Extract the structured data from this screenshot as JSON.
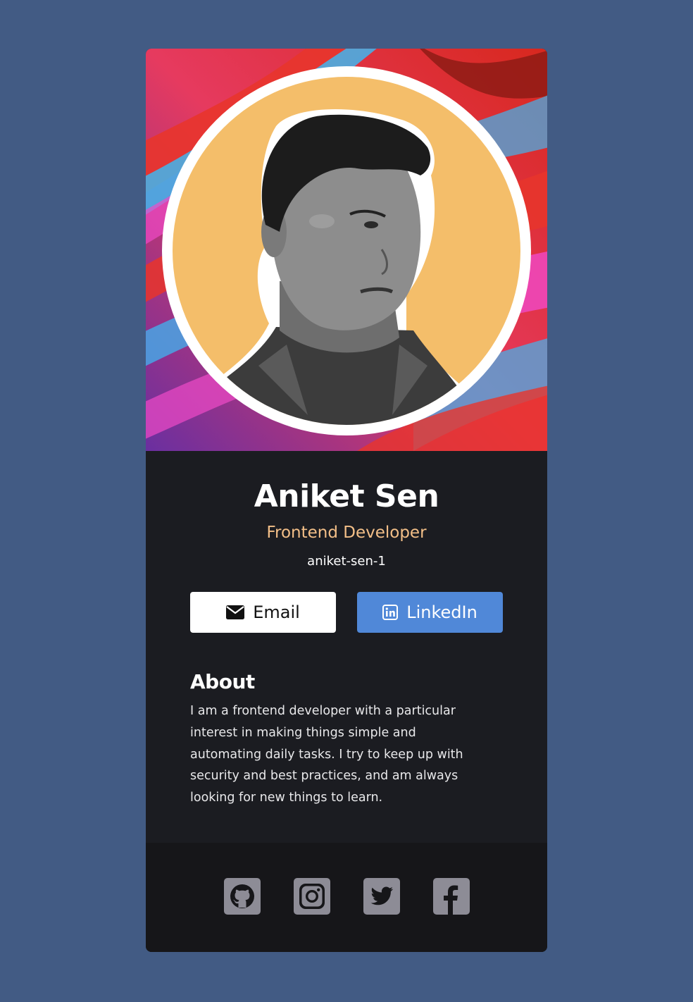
{
  "profile": {
    "name": "Aniket Sen",
    "role": "Frontend Developer",
    "handle": "aniket-sen-1"
  },
  "buttons": {
    "email": {
      "label": "Email",
      "icon": "envelope-icon"
    },
    "linkedin": {
      "label": "LinkedIn",
      "icon": "linkedin-icon"
    }
  },
  "about": {
    "title": "About",
    "text": "I am a frontend developer with a particular interest in making things simple and automating daily tasks. I try to keep up with security and best practices, and am always looking for new things to learn."
  },
  "social": [
    "github-icon",
    "instagram-icon",
    "twitter-icon",
    "facebook-icon"
  ],
  "colors": {
    "page_background": "#425b84",
    "card_background": "#1b1c21",
    "footer_background": "#161619",
    "accent_role": "#f3bf88",
    "linkedin_blue": "#5088d8",
    "avatar_circle": "#f4be6a",
    "social_icon": "#8d8c96"
  }
}
